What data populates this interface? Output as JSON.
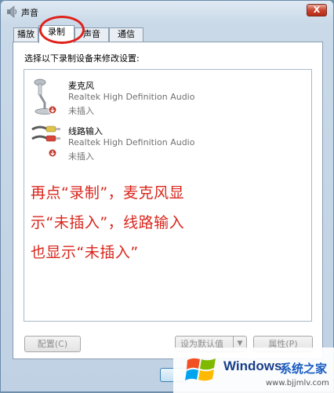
{
  "window": {
    "title": "声音",
    "close_label": "X"
  },
  "tabs": [
    {
      "label": "播放",
      "active": false
    },
    {
      "label": "录制",
      "active": true
    },
    {
      "label": "声音",
      "active": false
    },
    {
      "label": "通信",
      "active": false
    }
  ],
  "instruction": "选择以下录制设备来修改设置:",
  "devices": [
    {
      "name": "麦克风",
      "driver": "Realtek High Definition Audio",
      "status": "未插入",
      "icon": "microphone-icon"
    },
    {
      "name": "线路输入",
      "driver": "Realtek High Definition Audio",
      "status": "未插入",
      "icon": "line-in-icon"
    }
  ],
  "annotation": {
    "line1": "再点“录制”，麦克风显",
    "line2": "示“未插入”，线路输入",
    "line3": "也显示“未插入”",
    "color": "#d9261c"
  },
  "buttons": {
    "configure": "配置(C)",
    "set_default": "设为默认值(S)",
    "properties": "属性(P)"
  },
  "watermark": {
    "brand": "Windows",
    "cn": "系统之家",
    "url": "www.bjjmlv.com"
  }
}
